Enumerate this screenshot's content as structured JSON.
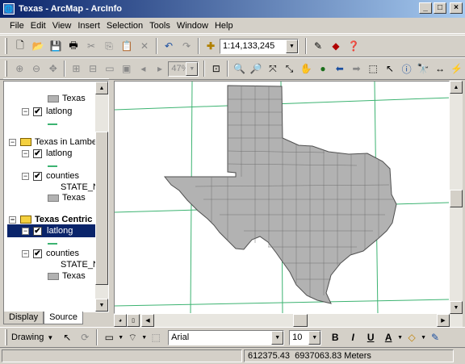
{
  "window": {
    "title": "Texas - ArcMap - ArcInfo"
  },
  "menu": [
    "File",
    "Edit",
    "View",
    "Insert",
    "Selection",
    "Tools",
    "Window",
    "Help"
  ],
  "standard_toolbar": {
    "scale": "1:14,133,245"
  },
  "layout_toolbar": {
    "zoom_percent": "47%"
  },
  "toc": {
    "items": [
      {
        "kind": "legend",
        "label": "Texas"
      },
      {
        "kind": "layer",
        "label": "latlong",
        "checked": true
      },
      {
        "kind": "frame",
        "label": "Texas in Lambert C"
      },
      {
        "kind": "layer",
        "label": "latlong",
        "checked": true
      },
      {
        "kind": "layer",
        "label": "counties",
        "checked": true
      },
      {
        "kind": "field",
        "label": "STATE_NA"
      },
      {
        "kind": "legend",
        "label": "Texas"
      },
      {
        "kind": "frame",
        "label": "Texas Centric",
        "active": true
      },
      {
        "kind": "layer",
        "label": "latlong",
        "checked": true,
        "selected": true
      },
      {
        "kind": "layer",
        "label": "counties",
        "checked": true
      },
      {
        "kind": "field",
        "label": "STATE_NA"
      },
      {
        "kind": "legend",
        "label": "Texas"
      }
    ]
  },
  "tabs": {
    "display": "Display",
    "source": "Source"
  },
  "draw_toolbar": {
    "drawing_label": "Drawing",
    "font": "Arial",
    "size": "10",
    "bold": "B",
    "italic": "I",
    "underline": "U",
    "font_color_glyph": "A"
  },
  "status": {
    "coordinates": "612375.43  6937063.83 Meters"
  },
  "colors": {
    "title_bar": "#0a246a",
    "chrome": "#d4d0c8",
    "texas_fill": "#b2b2b2",
    "graticule": "#3cb371",
    "selection": "#0a246a"
  }
}
